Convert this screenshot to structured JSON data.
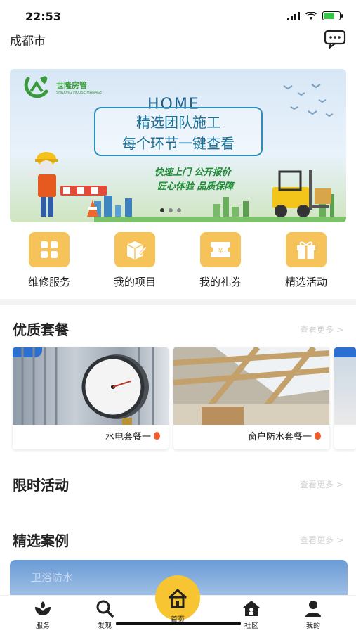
{
  "status": {
    "time": "22:53"
  },
  "header": {
    "city": "成都市",
    "message_icon": "message-icon"
  },
  "banner": {
    "brand_name": "世隆房管",
    "brand_sub": "SHILONG HOUSE MANAGE",
    "home_word": "HOME",
    "headline_line1": "精选团队施工",
    "headline_line2": "每个环节一键查看",
    "tagline1": "快速上门 公开报价",
    "tagline2": "匠心体验 品质保障"
  },
  "quick_menu": [
    {
      "label": "维修服务",
      "icon": "grid-icon"
    },
    {
      "label": "我的项目",
      "icon": "box-edit-icon"
    },
    {
      "label": "我的礼券",
      "icon": "ticket-icon"
    },
    {
      "label": "精选活动",
      "icon": "gift-icon"
    }
  ],
  "sections": {
    "packages": {
      "title": "优质套餐",
      "more": "查看更多 >"
    },
    "promotions": {
      "title": "限时活动",
      "more": "查看更多 >"
    },
    "cases": {
      "title": "精选案例",
      "more": "查看更多 >",
      "preview_text": "卫浴防水"
    }
  },
  "packages": [
    {
      "name": "水电套餐一"
    },
    {
      "name": "窗户防水套餐一"
    }
  ],
  "tabbar": [
    {
      "label": "服务",
      "icon": "service-icon"
    },
    {
      "label": "发现",
      "icon": "search-icon"
    },
    {
      "label": "首页",
      "icon": "home-icon"
    },
    {
      "label": "社区",
      "icon": "community-icon"
    },
    {
      "label": "我的",
      "icon": "profile-icon"
    }
  ],
  "colors": {
    "accent": "#f6c531",
    "icon_tile": "#f6c35b",
    "banner_text": "#19719a",
    "brand_green": "#3a9a3a"
  }
}
